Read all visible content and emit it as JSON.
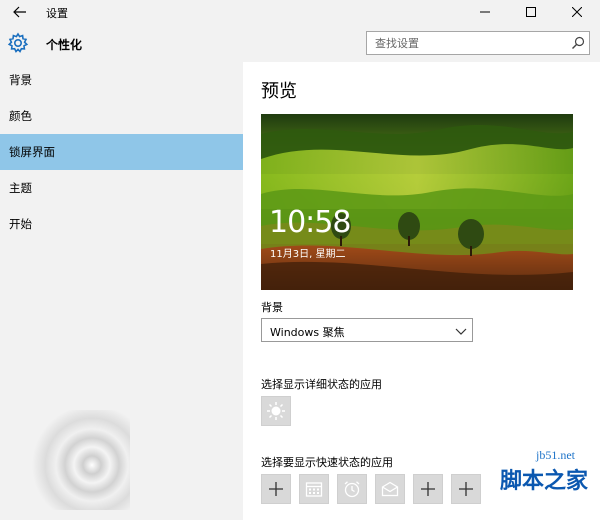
{
  "window": {
    "title": "设置",
    "back_icon": "back-arrow-icon",
    "minimize_icon": "minimize-icon",
    "maximize_icon": "maximize-icon",
    "close_icon": "close-icon"
  },
  "header": {
    "section_title": "个性化",
    "section_icon": "gear-icon",
    "search_placeholder": "查找设置",
    "search_icon": "search-icon"
  },
  "sidebar": {
    "items": [
      {
        "label": "背景",
        "active": false
      },
      {
        "label": "颜色",
        "active": false
      },
      {
        "label": "锁屏界面",
        "active": true
      },
      {
        "label": "主题",
        "active": false
      },
      {
        "label": "开始",
        "active": false
      }
    ],
    "active_color": "#8fc6e8"
  },
  "main": {
    "title": "预览",
    "preview": {
      "time": "10:58",
      "date": "11月3日, 星期二"
    },
    "background_label": "背景",
    "background_value": "Windows 聚焦",
    "detail_label": "选择显示详细状态的应用",
    "detail_apps": [
      {
        "icon": "sun-weather-icon"
      }
    ],
    "quick_label": "选择要显示快速状态的应用",
    "quick_apps": [
      {
        "icon": "plus-icon"
      },
      {
        "icon": "calendar-icon"
      },
      {
        "icon": "alarm-clock-icon"
      },
      {
        "icon": "mail-icon"
      },
      {
        "icon": "plus-icon"
      },
      {
        "icon": "plus-icon"
      }
    ]
  },
  "watermark": {
    "url": "jb51.net",
    "brand": "脚本之家"
  }
}
